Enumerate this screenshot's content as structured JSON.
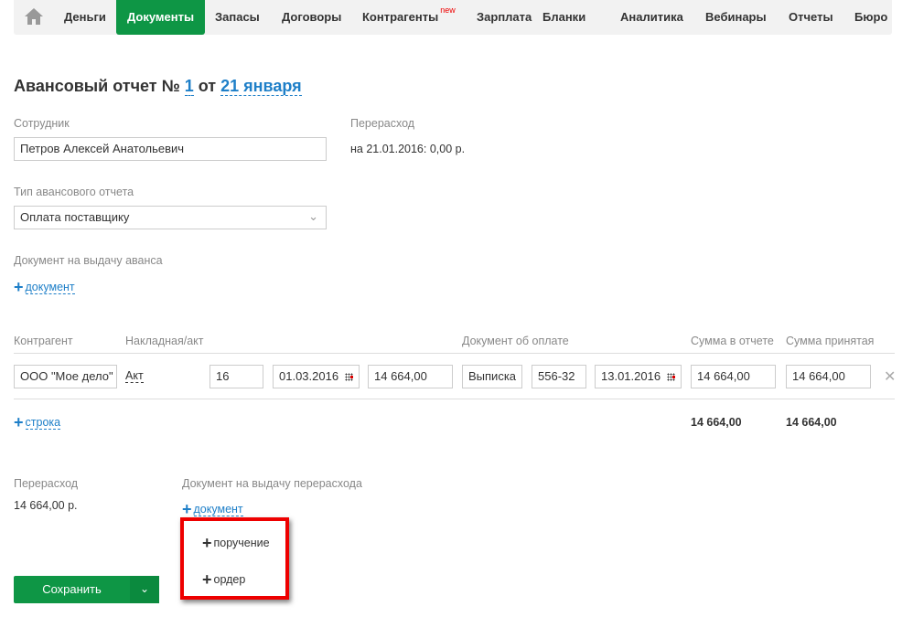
{
  "nav": {
    "home_icon": "home-icon",
    "items": [
      {
        "label": "Деньги"
      },
      {
        "label": "Документы",
        "active": true
      },
      {
        "label": "Запасы"
      },
      {
        "label": "Договоры"
      },
      {
        "label": "Контрагенты",
        "badge": "new"
      },
      {
        "label": "Зарплата"
      },
      {
        "label": "Бланки"
      },
      {
        "label": "Аналитика"
      },
      {
        "label": "Вебинары"
      },
      {
        "label": "Отчеты"
      },
      {
        "label": "Бюро"
      }
    ]
  },
  "title": {
    "prefix": "Авансовый отчет №",
    "number": "1",
    "from": "от",
    "date": "21 января"
  },
  "employee": {
    "label": "Сотрудник",
    "value": "Петров Алексей Анатольевич"
  },
  "overspend_top": {
    "label": "Перерасход",
    "value": "на 21.01.2016: 0,00 р."
  },
  "report_type": {
    "label": "Тип авансового отчета",
    "value": "Оплата поставщику"
  },
  "advance_doc": {
    "label": "Документ на выдачу аванса",
    "add_label": "документ"
  },
  "table": {
    "headers": [
      "Контрагент",
      "Накладная/акт",
      "Документ об оплате",
      "Сумма в отчете",
      "Сумма принятая"
    ],
    "row": {
      "counterparty": "ООО \"Мое дело\"",
      "invoice_type": "Акт",
      "invoice_number": "16",
      "invoice_date": "01.03.2016",
      "invoice_sum": "14 664,00",
      "payment_type": "Выписка",
      "payment_number": "556-32",
      "payment_date": "13.01.2016",
      "sum_report": "14 664,00",
      "sum_accepted": "14 664,00"
    },
    "add_row_label": "строка",
    "total_report": "14 664,00",
    "total_accepted": "14 664,00"
  },
  "overspend": {
    "label": "Перерасход",
    "value": "14 664,00 р."
  },
  "overspend_doc": {
    "label": "Документ на выдачу перерасхода",
    "add_label": "документ",
    "menu": [
      {
        "label": "поручение"
      },
      {
        "label": "ордер"
      }
    ]
  },
  "save": {
    "label": "Сохранить"
  },
  "colors": {
    "accent": "#0e9645",
    "link": "#1e7fc8",
    "highlight": "#ee0000"
  }
}
